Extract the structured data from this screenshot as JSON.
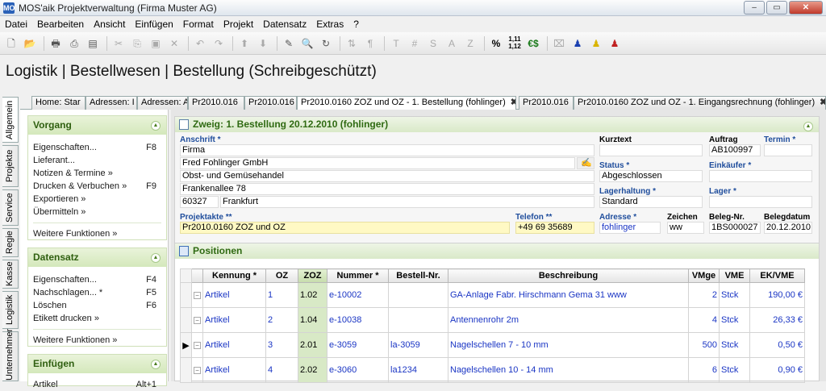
{
  "window": {
    "title": "MOS'aik Projektverwaltung (Firma Muster AG)",
    "app_icon": "MO"
  },
  "menu": [
    "Datei",
    "Bearbeiten",
    "Ansicht",
    "Einfügen",
    "Format",
    "Projekt",
    "Datensatz",
    "Extras",
    "?"
  ],
  "toolbar": {
    "icons": [
      "new-icon",
      "open-icon",
      "print-icon",
      "print-preview-icon",
      "print-setup-icon",
      "cut-icon",
      "copy-icon",
      "paste-icon",
      "delete-icon",
      "undo-icon",
      "redo-icon",
      "move-up-icon",
      "move-down-icon",
      "edit-icon",
      "find-icon",
      "refresh-icon",
      "sort-icon",
      "format-icon",
      "text-T-icon",
      "hash-icon",
      "S-icon",
      "A-icon",
      "Z-icon",
      "percent-icon",
      "decimal-icon",
      "currency-icon",
      "calculator-icon",
      "user-blue-icon",
      "user-yellow-icon",
      "user-red-icon"
    ]
  },
  "page_title": "Logistik | Bestellwesen | Bestellung (Schreibgeschützt)",
  "vertical_tabs": [
    "Allgemein",
    "Projekte",
    "Service",
    "Regie",
    "Kasse",
    "Logistik",
    "Unternehmer"
  ],
  "tabs": [
    {
      "label": "Home: Star"
    },
    {
      "label": "Adressen: I"
    },
    {
      "label": "Adressen: A"
    },
    {
      "label": "Pr2010.016"
    },
    {
      "label": "Pr2010.016"
    },
    {
      "label": "Pr2010.0160 ZOZ und OZ - 1. Bestellung (fohlinger)",
      "close": "✖"
    },
    {
      "label": "Pr2010.016"
    },
    {
      "label": "Pr2010.0160 ZOZ und OZ - 1. Eingangsrechnung (fohlinger)",
      "close": "✖"
    }
  ],
  "sidebar": {
    "vorgang": {
      "title": "Vorgang",
      "items": [
        {
          "label": "Eigenschaften...",
          "key": "F8"
        },
        {
          "label": "Lieferant...",
          "key": ""
        },
        {
          "label": "Notizen & Termine »",
          "key": ""
        },
        {
          "label": "Drucken & Verbuchen »",
          "key": "F9"
        },
        {
          "label": "Exportieren »",
          "key": ""
        },
        {
          "label": "Übermitteln »",
          "key": ""
        }
      ],
      "more": "Weitere Funktionen »"
    },
    "datensatz": {
      "title": "Datensatz",
      "items": [
        {
          "label": "Eigenschaften...",
          "key": "F4"
        },
        {
          "label": "Nachschlagen... *",
          "key": "F5"
        },
        {
          "label": "Löschen",
          "key": "F6"
        },
        {
          "label": "Etikett drucken »",
          "key": ""
        }
      ],
      "more": "Weitere Funktionen »"
    },
    "einfuegen": {
      "title": "Einfügen",
      "items": [
        {
          "label": "Artikel",
          "key": "Alt+1"
        }
      ]
    }
  },
  "zweig": {
    "title": "Zweig: 1. Bestellung 20.12.2010 (fohlinger)",
    "anschrift_label": "Anschrift *",
    "anschrift": [
      "Firma",
      "Fred Fohlinger GmbH",
      "Obst- und Gemüsehandel",
      "Frankenallee 78"
    ],
    "plz": "60327",
    "ort": "Frankfurt",
    "kurztext_label": "Kurztext",
    "kurztext": "",
    "auftrag_label": "Auftrag",
    "auftrag": "AB100997",
    "termin_label": "Termin *",
    "termin": "",
    "status_label": "Status *",
    "status": "Abgeschlossen",
    "einkaeufer_label": "Einkäufer *",
    "einkaeufer": "",
    "lagerhaltung_label": "Lagerhaltung *",
    "lagerhaltung": "Standard",
    "lager_label": "Lager *",
    "lager": "",
    "projektakte_label": "Projektakte **",
    "projektakte": "Pr2010.0160 ZOZ und OZ",
    "telefon_label": "Telefon **",
    "telefon": "+49 69 35689",
    "adresse_label": "Adresse *",
    "adresse": "fohlinger",
    "zeichen_label": "Zeichen",
    "zeichen": "ww",
    "belegnr_label": "Beleg-Nr.",
    "belegnr": "1BS000027",
    "belegdatum_label": "Belegdatum",
    "belegdatum": "20.12.2010"
  },
  "positionen": {
    "title": "Positionen",
    "columns": [
      "Kennung *",
      "OZ",
      "ZOZ",
      "Nummer *",
      "Bestell-Nr.",
      "Beschreibung",
      "VMge",
      "VME",
      "EK/VME"
    ],
    "rows": [
      [
        "Artikel",
        "1",
        "1.02",
        "e-10002",
        "",
        "GA-Anlage Fabr. Hirschmann Gema 31 www",
        "2",
        "Stck",
        "190,00 €"
      ],
      [
        "Artikel",
        "2",
        "1.04",
        "e-10038",
        "",
        "Antennenrohr 2m",
        "4",
        "Stck",
        "26,33 €"
      ],
      [
        "Artikel",
        "3",
        "2.01",
        "e-3059",
        "la-3059",
        "Nagelschellen 7 - 10 mm",
        "500",
        "Stck",
        "0,50 €"
      ],
      [
        "Artikel",
        "4",
        "2.02",
        "e-3060",
        "la1234",
        "Nagelschellen 10 - 14 mm",
        "6",
        "Stck",
        "0,90 €"
      ]
    ]
  }
}
